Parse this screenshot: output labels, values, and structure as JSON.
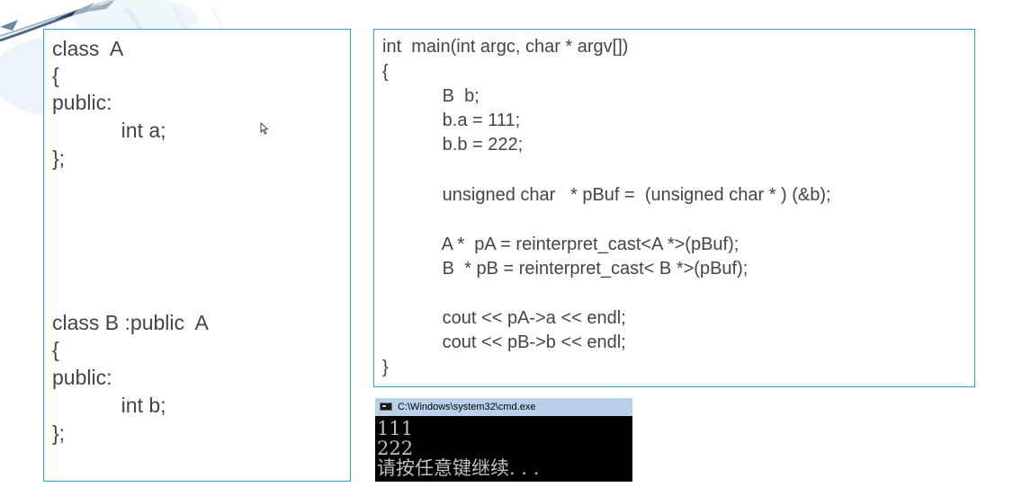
{
  "left_code": {
    "lines": [
      "class  A",
      "{",
      "public:",
      "            int a;",
      "};",
      "class B :public  A",
      "{",
      "public:",
      "            int b;",
      "};"
    ]
  },
  "right_code": {
    "lines": [
      "int  main(int argc, char * argv[])",
      "{",
      "            B  b;",
      "            b.a = 111;",
      "            b.b = 222;",
      "            unsigned char   * pBuf =  (unsigned char * ) (&b);",
      "            A *  pA = reinterpret_cast<A *>(pBuf);",
      "            B  * pB = reinterpret_cast< B *>(pBuf);",
      "            cout << pA->a << endl;",
      "            cout << pB->b << endl;",
      "}"
    ]
  },
  "console": {
    "title": "C:\\Windows\\system32\\cmd.exe",
    "lines": [
      "111",
      "222",
      "请按任意键继续. . ."
    ]
  }
}
